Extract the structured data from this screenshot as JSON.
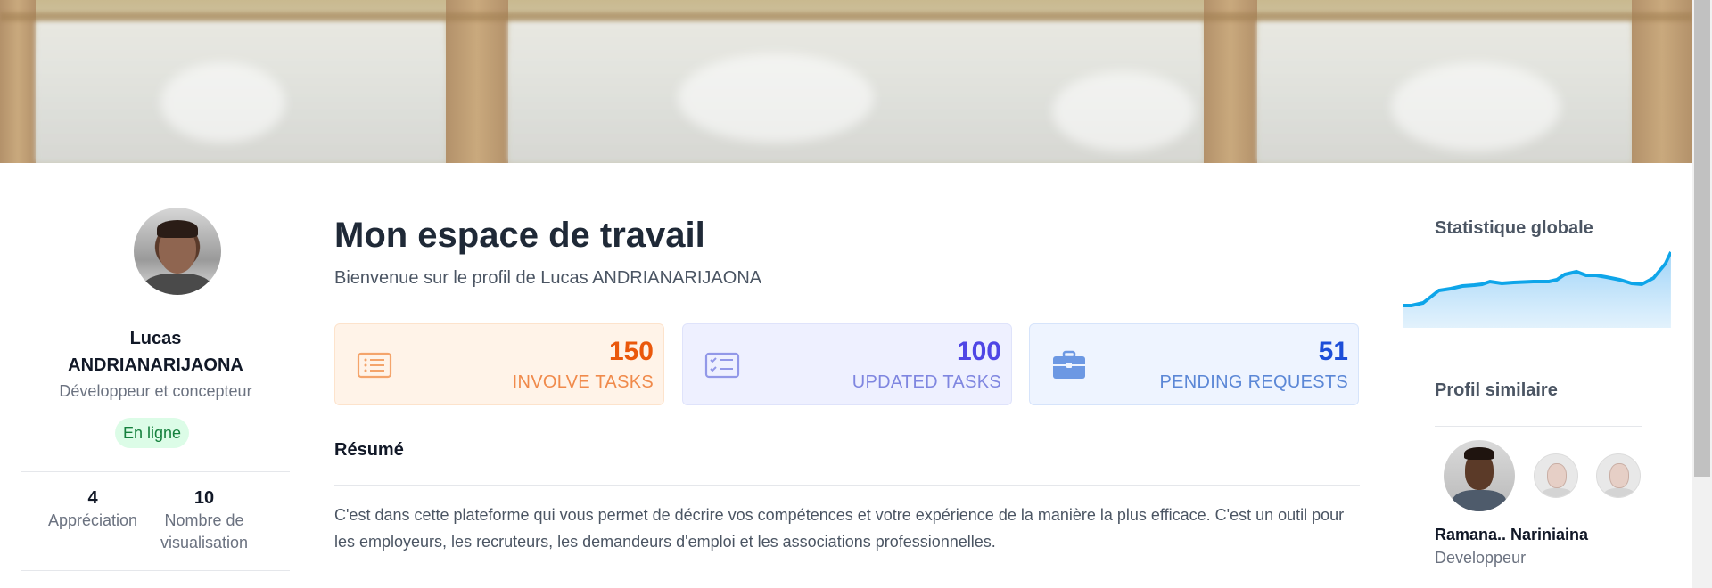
{
  "profile": {
    "first_name": "Lucas",
    "last_name": "ANDRIANARIJAONA",
    "role": "Développeur et concepteur",
    "status": "En ligne",
    "stats": [
      {
        "value": "4",
        "label": "Appréciation"
      },
      {
        "value": "10",
        "label": "Nombre de visualisation"
      }
    ]
  },
  "main": {
    "title": "Mon espace de travail",
    "subtitle": "Bienvenue sur le profil de Lucas ANDRIANARIJAONA",
    "cards": [
      {
        "value": "150",
        "label": "INVOLVE TASKS",
        "icon": "list-icon",
        "accent": "#ea580c"
      },
      {
        "value": "100",
        "label": "UPDATED TASKS",
        "icon": "checklist-icon",
        "accent": "#4f46e5"
      },
      {
        "value": "51",
        "label": "PENDING REQUESTS",
        "icon": "briefcase-icon",
        "accent": "#1d4ed8"
      }
    ],
    "summary_title": "Résumé",
    "summary_text": "C'est dans cette plateforme qui vous permet de décrire vos compétences et votre expérience de la manière la plus efficace. C'est un outil pour les employeurs, les recruteurs, les demandeurs d'emploi et les associations professionnelles."
  },
  "sidebar": {
    "stats_title": "Statistique globale",
    "similar_title": "Profil similaire",
    "similar_name": "Ramana.. Nariniaina",
    "similar_role": "Developpeur"
  },
  "colors": {
    "status_bg": "#dcfce7",
    "status_text": "#15803d",
    "sparkline": "#0ea5e9"
  }
}
